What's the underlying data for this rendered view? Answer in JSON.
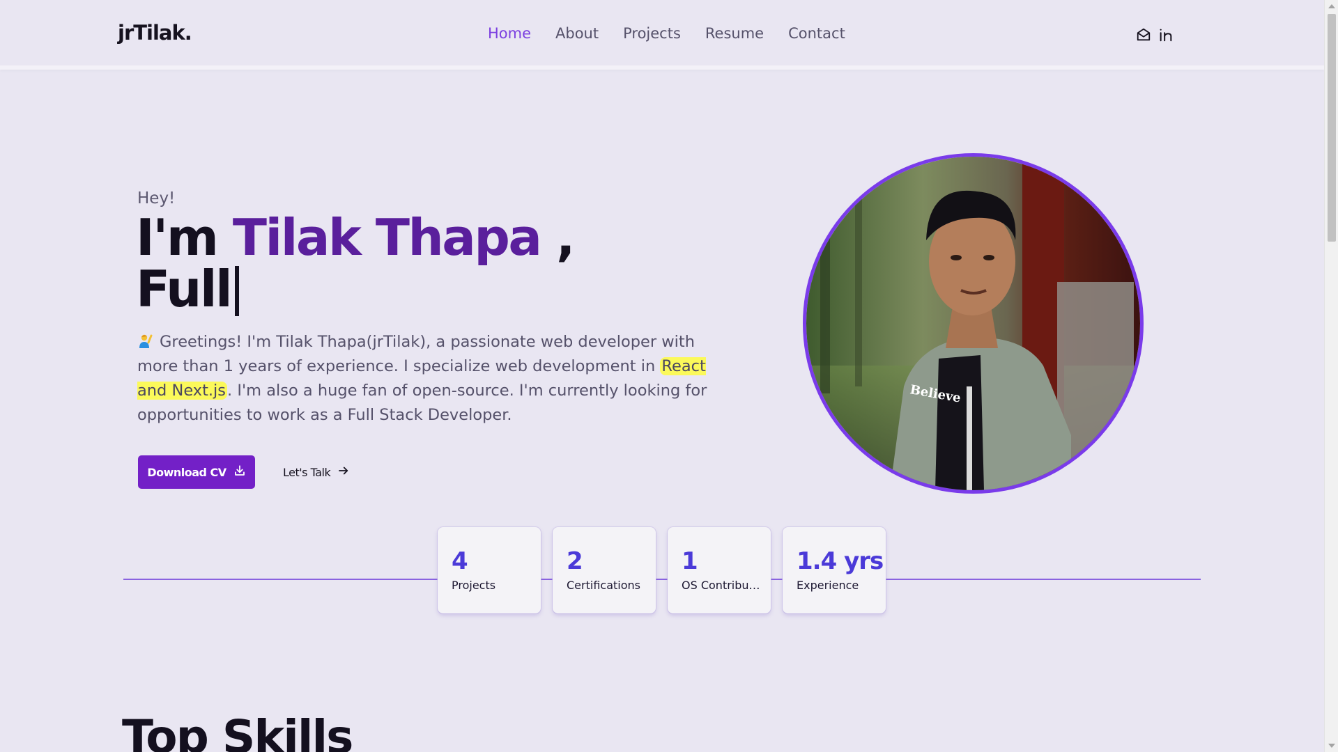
{
  "header": {
    "logo": "jrTilak.",
    "nav": [
      {
        "label": "Home",
        "active": true
      },
      {
        "label": "About",
        "active": false
      },
      {
        "label": "Projects",
        "active": false
      },
      {
        "label": "Resume",
        "active": false
      },
      {
        "label": "Contact",
        "active": false
      }
    ],
    "social_icons": [
      "mail-icon",
      "linkedin-icon"
    ]
  },
  "hero": {
    "greeting": "Hey!",
    "title_prefix": "I'm ",
    "name": "Tilak Thapa",
    "title_comma": " ,",
    "typed_text": "Full",
    "desc_before": "Greetings! I'm Tilak Thapa(jrTilak), a passionate web developer with more than 1 years of experience. I specialize web development in ",
    "desc_highlight": "React and Next.js",
    "desc_after": ". I'm also a huge fan of open-source. I'm currently looking for opportunities to work as a Full Stack Developer.",
    "primary_button": "Download CV",
    "secondary_button": "Let's Talk"
  },
  "stats": [
    {
      "value": "4",
      "label": "Projects"
    },
    {
      "value": "2",
      "label": "Certifications"
    },
    {
      "value": "1",
      "label": "OS Contribut..."
    },
    {
      "value": "1.4 yrs",
      "label": "Experience"
    }
  ],
  "skills": {
    "title": "Top Skills"
  },
  "colors": {
    "accent": "#7320c7",
    "name": "#5a1f9c",
    "stat_value": "#4b3ad8",
    "highlight": "#fbf95a",
    "background": "#e9e6f2"
  }
}
